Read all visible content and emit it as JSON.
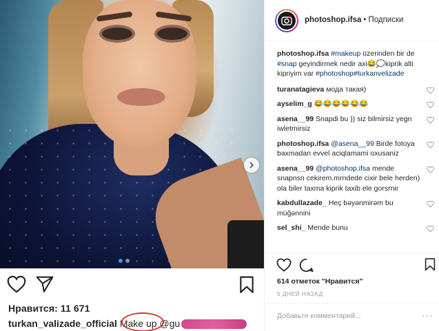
{
  "post": {
    "likes_label": "Нравится: 11 671",
    "caption_user": "turkan_valizade_official",
    "caption_text": "Make up @gu"
  },
  "header": {
    "handle": "photoshop.ifsa",
    "separator": "•",
    "follow": "Подписки"
  },
  "caption": {
    "user": "photoshop.ifsa",
    "hashtag1": "#makeup",
    "text1": " üzerinden bir de ",
    "hashtag2": "#snap",
    "text2": " geyindirmek nedir axi😂💭kiprik alti kipriyim var ",
    "hashtag3": "#photoshop",
    "hashtag4": "#turkanvelizade"
  },
  "comments": [
    {
      "user": "turanatagieva",
      "text": " мода такая)"
    },
    {
      "user": "ayselim_g",
      "text": " 😂😂😂😂😂😂"
    },
    {
      "user": "asena__99",
      "text": " Snapdi bu )) siz bilmirsiz yegn iwletmirsiz"
    },
    {
      "user": "photoshop.ifsa",
      "mention": " @asena__99",
      "text": " Birde fotoya baxmadan evvel aciqlamami oxusaniz"
    },
    {
      "user": "asena__99",
      "mention": " @photoshop.ifsa",
      "text": " mende snapnsn cekirem.mrndede cixir bele herden) ola biler taxma kiprik taxib ele gorsrnir"
    },
    {
      "user": "kabdullazade_",
      "text": " Heç bəyənmirəm bu müğənnini"
    },
    {
      "user": "sel_shi_",
      "text": " Mende bunu"
    }
  ],
  "panel": {
    "likes": "614 отметок \"Нравится\"",
    "time": "5 дней назад",
    "add_comment_placeholder": "Добавьте комментарий...",
    "more": "···"
  },
  "colors": {
    "hashtag": "#003569",
    "carousel_active": "#3897f0",
    "annotation": "#d9342b"
  }
}
